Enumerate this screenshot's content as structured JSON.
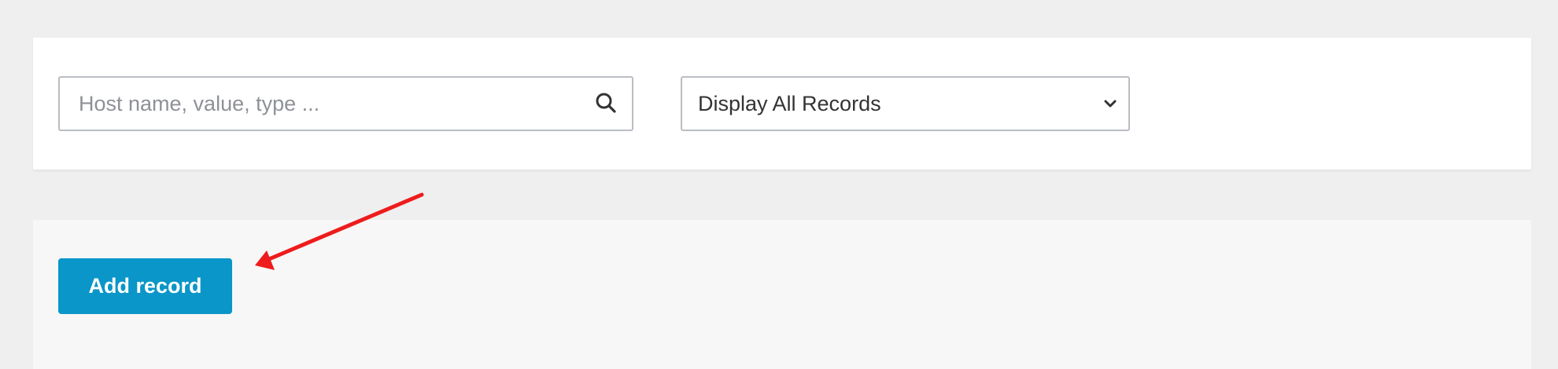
{
  "filters": {
    "search": {
      "placeholder": "Host name, value, type ...",
      "value": "",
      "icon": "search-icon"
    },
    "record_filter": {
      "selected": "Display All Records",
      "icon": "chevron-down-icon"
    }
  },
  "actions": {
    "add_record_label": "Add record"
  },
  "annotation": {
    "type": "arrow",
    "points_to": "add-record-button",
    "color": "#ee1c1c"
  },
  "colors": {
    "page_background": "#efefef",
    "card_background": "#ffffff",
    "actions_panel_background": "#f7f7f7",
    "primary_button": "#0a96c8",
    "input_border": "#b9bdc3"
  }
}
